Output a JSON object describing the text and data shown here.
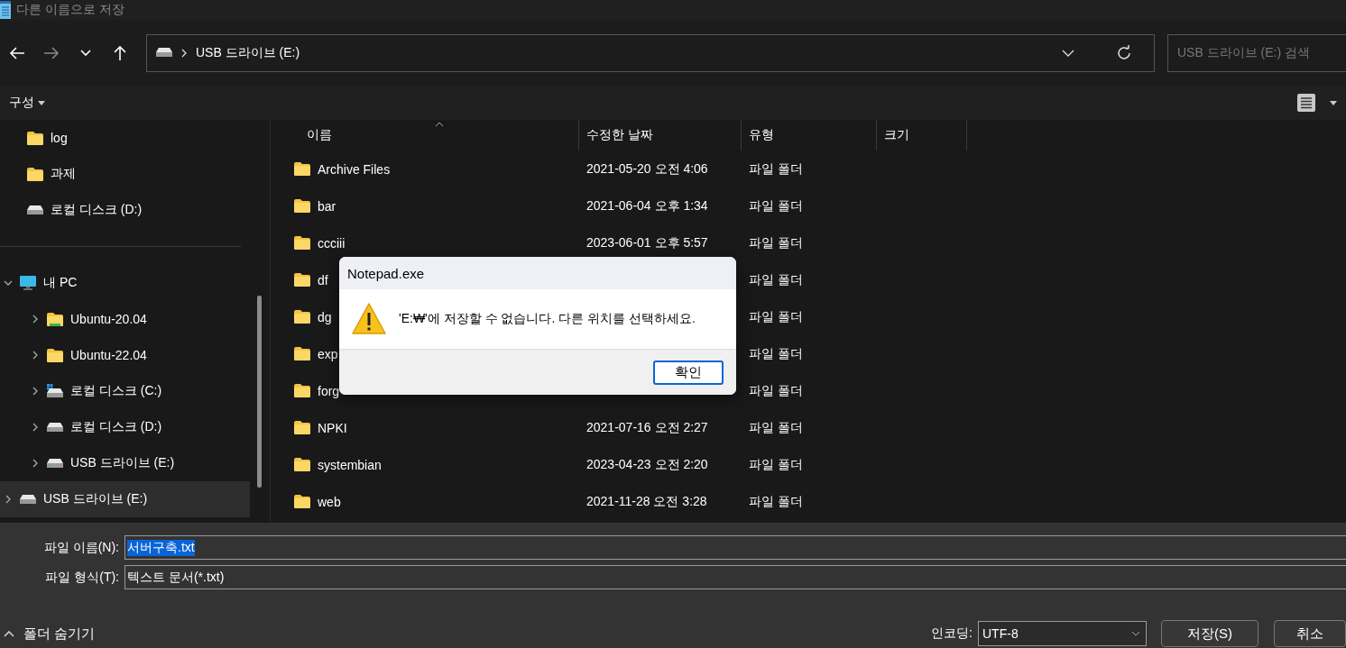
{
  "window": {
    "title": "다른 이름으로 저장"
  },
  "address": {
    "crumb": "USB 드라이브 (E:)",
    "search_placeholder": "USB 드라이브 (E:) 검색"
  },
  "toolbar": {
    "organize": "구성"
  },
  "sidebar": {
    "items": [
      {
        "label": "log",
        "kind": "folder",
        "selected": false
      },
      {
        "label": "과제",
        "kind": "folder",
        "selected": false
      },
      {
        "label": "로컬 디스크 (D:)",
        "kind": "drive",
        "selected": false
      }
    ],
    "tree": [
      {
        "label": "내 PC",
        "kind": "pc",
        "expanded": true,
        "selected": false,
        "children": [
          {
            "label": "Ubuntu-20.04",
            "kind": "linux-folder",
            "expanded": false,
            "selected": false
          },
          {
            "label": "Ubuntu-22.04",
            "kind": "folder",
            "expanded": false,
            "selected": false
          },
          {
            "label": "로컬 디스크 (C:)",
            "kind": "system-drive",
            "expanded": false,
            "selected": false
          },
          {
            "label": "로컬 디스크 (D:)",
            "kind": "drive",
            "expanded": false,
            "selected": false
          },
          {
            "label": "USB 드라이브 (E:)",
            "kind": "drive",
            "expanded": false,
            "selected": false
          }
        ]
      },
      {
        "label": "USB 드라이브 (E:)",
        "kind": "drive",
        "expanded": false,
        "selected": true
      }
    ]
  },
  "table": {
    "columns": [
      "이름",
      "수정한 날짜",
      "유형",
      "크기"
    ],
    "rows": [
      {
        "name": "Archive Files",
        "date": "2021-05-20 오전 4:06",
        "type": "파일 폴더"
      },
      {
        "name": "bar",
        "date": "2021-06-04 오후 1:34",
        "type": "파일 폴더"
      },
      {
        "name": "ccciii",
        "date": "2023-06-01 오후 5:57",
        "type": "파일 폴더"
      },
      {
        "name": "df",
        "type": "파일 폴더"
      },
      {
        "name": "dg",
        "type": "파일 폴더"
      },
      {
        "name": "exp",
        "type": "파일 폴더"
      },
      {
        "name": "forg",
        "type": "파일 폴더"
      },
      {
        "name": "NPKI",
        "date": "2021-07-16 오전 2:27",
        "type": "파일 폴더"
      },
      {
        "name": "systembian",
        "date": "2023-04-23 오전 2:20",
        "type": "파일 폴더"
      },
      {
        "name": "web",
        "date": "2021-11-28 오전 3:28",
        "type": "파일 폴더"
      }
    ]
  },
  "form": {
    "file_name": {
      "label": "파일 이름(N):",
      "value": "서버구축.txt",
      "selected": true
    },
    "file_type": {
      "label": "파일 형식(T):",
      "value": "텍스트 문서(*.txt)"
    },
    "hide_folders": "폴더 숨기기",
    "encoding_label": "인코딩:",
    "encoding": "UTF-8",
    "save": "저장(S)",
    "cancel": "취소"
  },
  "dialog": {
    "title": "Notepad.exe",
    "message": "'E:₩'에 저장할 수 없습니다. 다른 위치를 선택하세요.",
    "ok": "확인"
  }
}
